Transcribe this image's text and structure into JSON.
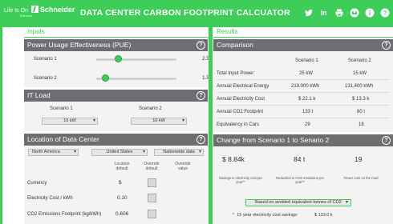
{
  "header": {
    "logo_prefix": "Life Is On",
    "logo_brand": "Schneider",
    "logo_sub": "Electric",
    "title": "DATA CENTER CARBON FOOTPRINT CALCUATOR",
    "linkedin_glyph": "in"
  },
  "columns": {
    "inputs": "Inputs",
    "results": "Results"
  },
  "pue": {
    "title": "Power Usage Effectiveness (PUE)",
    "scenarios": [
      {
        "label": "Scenario 1",
        "value": "2.50",
        "level": 0.62
      },
      {
        "label": "Scenario 2",
        "value": "1.50",
        "level": 0.06
      }
    ]
  },
  "it_load": {
    "title": "IT Load",
    "scenarios": [
      {
        "label": "Scenario 1",
        "value": "10 kW"
      },
      {
        "label": "Scenario 2",
        "value": "10 kW"
      }
    ]
  },
  "location": {
    "title": "Location of Data Center",
    "region": "North America",
    "country": "United States",
    "data_source": "Nationwide data",
    "col_location_default": "Location default",
    "col_override_default": "Override default",
    "col_override_value": "Override value",
    "rows": [
      {
        "label": "Currency",
        "default": "$"
      },
      {
        "label": "Electricity Cost / kWh",
        "default": "0.10"
      },
      {
        "label": "CO2 Emissions Footprint (kg/kWh)",
        "default": "0.606"
      }
    ]
  },
  "comparison": {
    "title": "Comparison",
    "col_s1": "Scenario 1",
    "col_s2": "Scenario 2",
    "rows": [
      {
        "label": "Total Input Power",
        "s1": "25 kW",
        "s2": "15 kW"
      },
      {
        "label": "Annual Electrical Energy",
        "s1": "219,000 kWh",
        "s2": "131,400 kWh"
      },
      {
        "label": "Annual Electricity Cost",
        "s1": "$ 22.1 k",
        "s2": "$ 13.3 k"
      },
      {
        "label": "Annual CO2 Footprint",
        "s1": "133 t",
        "s2": "80 t"
      },
      {
        "label": "Equivalency in Cars",
        "s1": "29",
        "s2": "18"
      }
    ]
  },
  "change": {
    "title": "Change from Scenario 1 to Senario 2",
    "savings_value": "$ 8.84k",
    "co2_value": "84 t",
    "cars_value": "19",
    "savings_label": "Savings in electricity cost per year**",
    "co2_label": "Reduction in CO2 emissions per year**",
    "cars_label": "Fewer cars on the road",
    "basis": "Based on avoided equivalent tonnes of CO2",
    "fifteen_year_label": "15 year electricity cost savings:",
    "fifteen_year_value": "$ 133.0 k"
  },
  "colors": {
    "brand": "#3dcd58",
    "panel_header": "#6d6e71"
  },
  "icons": [
    "twitter-icon",
    "linkedin-icon",
    "print-icon",
    "email-icon",
    "info-icon",
    "help-icon"
  ]
}
